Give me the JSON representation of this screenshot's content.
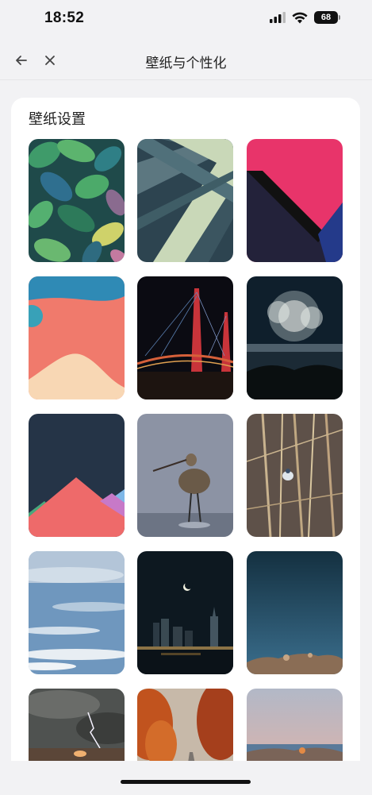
{
  "status_bar": {
    "time": "18:52",
    "battery_level": "68",
    "icons": [
      "signal-icon",
      "wifi-icon",
      "battery-icon"
    ]
  },
  "nav": {
    "title": "壁纸与个性化",
    "back_icon": "arrow-left-icon",
    "close_icon": "close-icon"
  },
  "section": {
    "title": "壁纸设置"
  },
  "wallpapers": [
    {
      "name": "green-leaves"
    },
    {
      "name": "geometric-stripes"
    },
    {
      "name": "pink-navy-abstract"
    },
    {
      "name": "coral-waves"
    },
    {
      "name": "night-bridge"
    },
    {
      "name": "fireworks"
    },
    {
      "name": "pink-mountains"
    },
    {
      "name": "wading-bird"
    },
    {
      "name": "reeds-bird"
    },
    {
      "name": "blue-sky-clouds"
    },
    {
      "name": "night-city-moon"
    },
    {
      "name": "ocean-dusk"
    },
    {
      "name": "lightning-storm"
    },
    {
      "name": "autumn-road"
    },
    {
      "name": "pastel-coast"
    }
  ]
}
